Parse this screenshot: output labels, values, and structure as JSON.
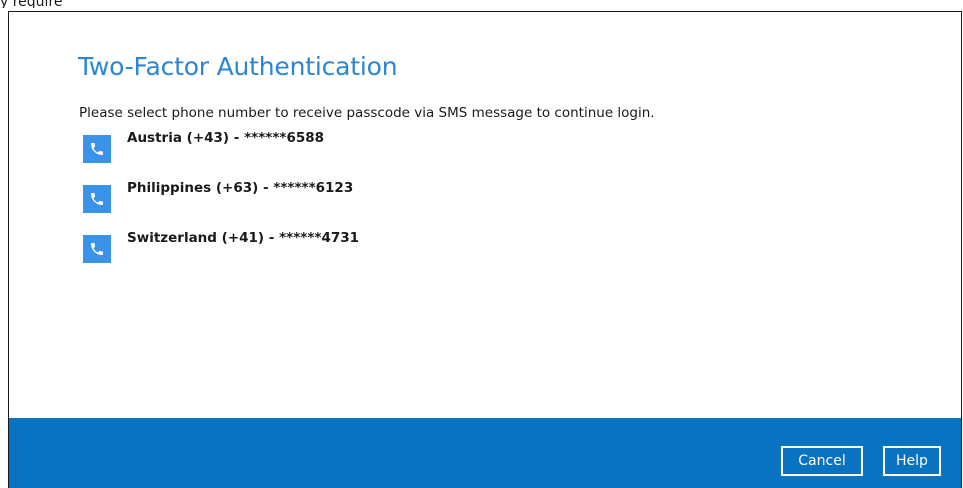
{
  "snippet": "y require",
  "dialog": {
    "title": "Two-Factor Authentication",
    "instruction": "Please select phone number to receive passcode via SMS message to continue login.",
    "phones": [
      {
        "label": "Austria (+43) - ******6588",
        "icon": "phone-icon"
      },
      {
        "label": "Philippines (+63) - ******6123",
        "icon": "phone-icon"
      },
      {
        "label": "Switzerland (+41) - ******4731",
        "icon": "phone-icon"
      }
    ]
  },
  "footer": {
    "cancel_label": "Cancel",
    "help_label": "Help"
  },
  "colors": {
    "accent": "#2b86d4",
    "footer": "#0a73c1",
    "icon_bg": "#3a93e8"
  }
}
